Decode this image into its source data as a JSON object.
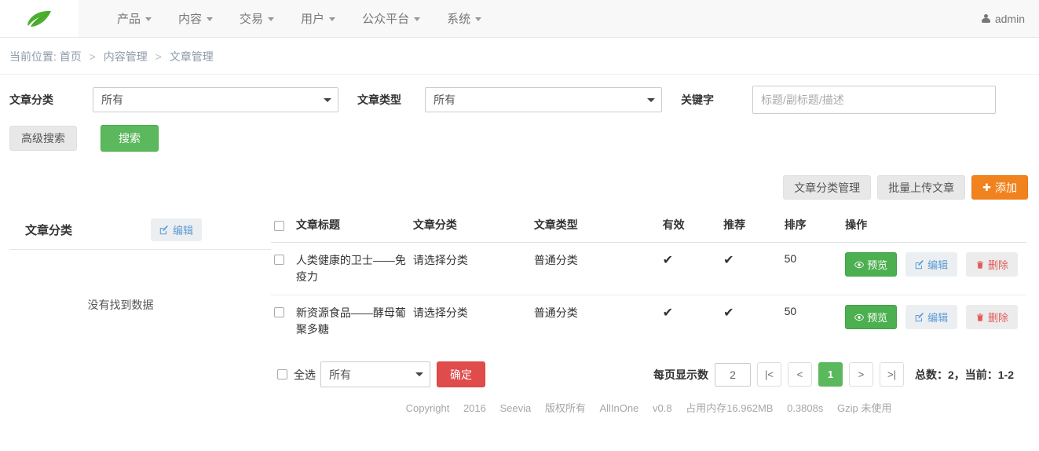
{
  "navbar": {
    "logo_alt": "seevia-leaf-logo",
    "items": [
      {
        "label": "产品",
        "has_caret": true
      },
      {
        "label": "内容",
        "has_caret": true
      },
      {
        "label": "交易",
        "has_caret": true
      },
      {
        "label": "用户",
        "has_caret": true
      },
      {
        "label": "公众平台",
        "has_caret": true
      },
      {
        "label": "系统",
        "has_caret": true
      }
    ],
    "user": "admin"
  },
  "breadcrumb": {
    "prefix": "当前位置:",
    "items": [
      "首页",
      "内容管理",
      "文章管理"
    ],
    "separator": ">"
  },
  "search": {
    "category_label": "文章分类",
    "category_value": "所有",
    "category_options": [
      "所有"
    ],
    "type_label": "文章类型",
    "type_value": "所有",
    "type_options": [
      "所有"
    ],
    "keyword_label": "关键字",
    "keyword_value": "",
    "keyword_placeholder": "标题/副标题/描述",
    "advanced_button": "高级搜索",
    "search_button": "搜索"
  },
  "toolbar": {
    "manage_categories": "文章分类管理",
    "bulk_upload": "批量上传文章",
    "add": "添加",
    "add_icon": "plus-icon"
  },
  "left_panel": {
    "title": "文章分类",
    "edit_button": "编辑",
    "edit_icon": "pencil-square-icon",
    "empty_message": "没有找到数据"
  },
  "table": {
    "columns": [
      "文章标题",
      "文章分类",
      "文章类型",
      "有效",
      "推荐",
      "排序",
      "操作"
    ],
    "rows": [
      {
        "title": "人类健康的卫士——免疫力",
        "category": "请选择分类",
        "type": "普通分类",
        "valid": "✔",
        "recommend": "✔",
        "sort": "50",
        "preview": "预览",
        "edit": "编辑",
        "delete": "删除"
      },
      {
        "title": "新资源食品——酵母葡聚多糖",
        "category": "请选择分类",
        "type": "普通分类",
        "valid": "✔",
        "recommend": "✔",
        "sort": "50",
        "preview": "预览",
        "edit": "编辑",
        "delete": "删除"
      }
    ],
    "op_icons": {
      "preview": "eye-icon",
      "edit": "pencil-square-icon",
      "delete": "trash-icon"
    }
  },
  "bottombar": {
    "select_all_label": "全选",
    "bulk_action_value": "所有",
    "bulk_action_options": [
      "所有"
    ],
    "confirm_button": "确定",
    "per_page_label": "每页显示数",
    "per_page_value": "2",
    "pager": {
      "first": "|<",
      "prev": "<",
      "current": "1",
      "next": ">",
      "last": ">|"
    },
    "total_text": "总数：2，当前：1-2"
  },
  "footer": {
    "parts": [
      "Copyright",
      "2016",
      "Seevia",
      "版权所有",
      "AllInOne",
      "v0.8",
      "占用内存16.962MB",
      "0.3808s",
      "Gzip 未使用"
    ]
  },
  "colors": {
    "green": "#5cb85c",
    "orange": "#f0831e",
    "red": "#e04b4b",
    "link_blue": "#5b9bd5",
    "tick_green": "#4fb352"
  }
}
